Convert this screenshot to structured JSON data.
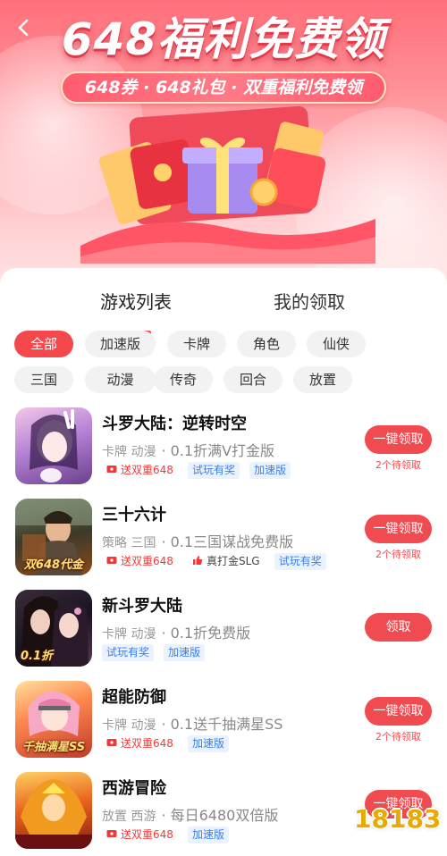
{
  "banner": {
    "title": "648福利免费领",
    "subtitle": "648券 · 648礼包 · 双重福利免费领"
  },
  "tabs": [
    {
      "label": "游戏列表",
      "active": true
    },
    {
      "label": "我的领取",
      "active": false
    }
  ],
  "categories": [
    "全部",
    "加速版",
    "卡牌",
    "角色",
    "仙侠",
    "三国",
    "动漫",
    "传奇",
    "回合",
    "放置"
  ],
  "active_category": "全部",
  "games": [
    {
      "name": "斗罗大陆：逆转时空",
      "genres": "卡牌 动漫",
      "desc": "· 0.1折满V打金版",
      "tags": [
        {
          "text": "送双重648",
          "style": "red",
          "icon": "coupon-icon"
        },
        {
          "text": "试玩有奖",
          "style": "blue"
        },
        {
          "text": "加速版",
          "style": "blue"
        }
      ],
      "button": "一键领取",
      "pending": "2个待领取",
      "icon_caption": ""
    },
    {
      "name": "三十六计",
      "genres": "策略 三国",
      "desc": "· 0.1三国谋战免费版",
      "tags": [
        {
          "text": "送双重648",
          "style": "red",
          "icon": "coupon-icon"
        },
        {
          "text": "真打金SLG",
          "style": "red",
          "icon": "thumb-up-icon"
        },
        {
          "text": "试玩有奖",
          "style": "blue"
        }
      ],
      "button": "一键领取",
      "pending": "2个待领取",
      "icon_caption": "双648代金"
    },
    {
      "name": "新斗罗大陆",
      "genres": "卡牌 动漫",
      "desc": "· 0.1折免费版",
      "tags": [
        {
          "text": "试玩有奖",
          "style": "blue"
        },
        {
          "text": "加速版",
          "style": "blue"
        }
      ],
      "button": "领取",
      "pending": "",
      "icon_caption": "0.1折"
    },
    {
      "name": "超能防御",
      "genres": "卡牌 动漫",
      "desc": "· 0.1送千抽满星SS",
      "tags": [
        {
          "text": "送双重648",
          "style": "red",
          "icon": "coupon-icon"
        },
        {
          "text": "加速版",
          "style": "blue"
        }
      ],
      "button": "一键领取",
      "pending": "2个待领取",
      "icon_caption": "千抽满星SS"
    },
    {
      "name": "西游冒险",
      "genres": "放置 西游",
      "desc": "· 每日6480双倍版",
      "tags": [
        {
          "text": "送双重648",
          "style": "red",
          "icon": "coupon-icon"
        },
        {
          "text": "加速版",
          "style": "blue"
        }
      ],
      "button": "一键领取",
      "pending": "",
      "icon_caption": ""
    }
  ],
  "watermark": "18183",
  "colors": {
    "accent": "#f04b50",
    "tag_blue": "#3b7fe8",
    "banner_top": "#ff6f7a"
  }
}
